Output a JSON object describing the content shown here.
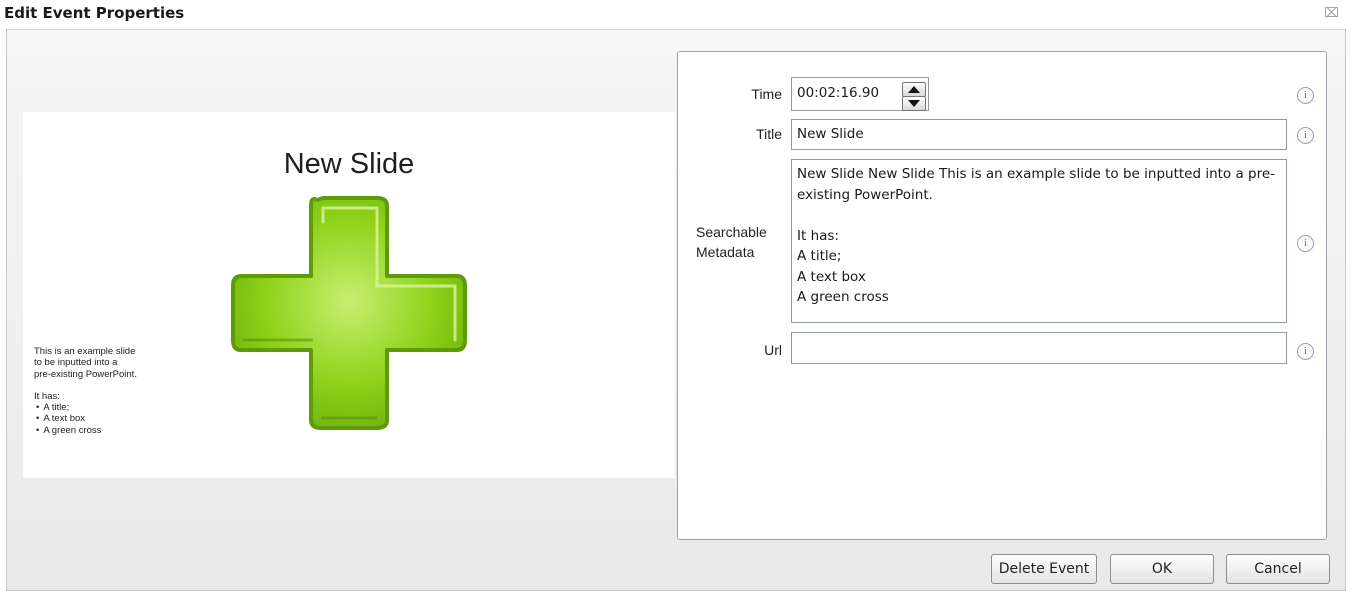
{
  "window": {
    "title": "Edit Event Properties",
    "close_icon": "close-icon"
  },
  "slide": {
    "title": "New Slide",
    "body_lines": [
      "This is an example slide",
      "to be inputted into a",
      "pre-existing PowerPoint."
    ],
    "body_subheading": "It has:",
    "bullets": [
      "A title;",
      "A text box",
      "A green cross"
    ],
    "cross_color": "#7cc40a"
  },
  "form": {
    "time": {
      "label": "Time",
      "value": "00:02:16.90"
    },
    "title": {
      "label": "Title",
      "value": "New Slide"
    },
    "metadata": {
      "label_line1": "Searchable",
      "label_line2": "Metadata",
      "value": "New Slide New Slide This is an example slide to be inputted into a pre-existing PowerPoint.\n\nIt has:\nA title;\nA text box\nA green cross"
    },
    "url": {
      "label": "Url",
      "value": ""
    },
    "info_icon": "info-icon"
  },
  "buttons": {
    "delete": "Delete Event",
    "ok": "OK",
    "cancel": "Cancel"
  }
}
